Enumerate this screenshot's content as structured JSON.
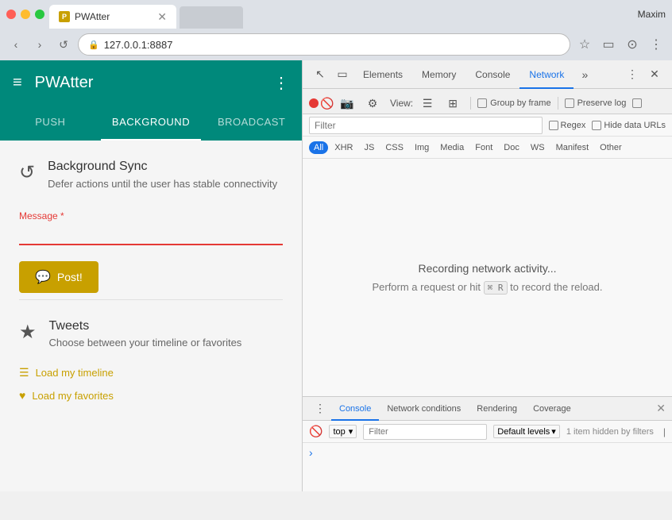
{
  "browser": {
    "traffic_lights": [
      "red",
      "yellow",
      "green"
    ],
    "tab": {
      "favicon_label": "P",
      "title": "PWAtter",
      "close": "✕"
    },
    "nav": {
      "back": "‹",
      "forward": "›",
      "reload": "↺",
      "url_icon": "🔒",
      "url": "127.0.0.1:8887",
      "bookmark": "☆",
      "cast": "▭",
      "profile": "⊙",
      "more": "⋮"
    },
    "user": "Maxim"
  },
  "app": {
    "header": {
      "menu_icon": "≡",
      "title": "PWAtter",
      "more_icon": "⋮"
    },
    "tabs": [
      {
        "label": "Push",
        "active": false
      },
      {
        "label": "Background",
        "active": true
      },
      {
        "label": "Broadcast",
        "active": false
      }
    ],
    "sync": {
      "icon": "↺",
      "title": "Background Sync",
      "description": "Defer actions until the user has stable connectivity"
    },
    "form": {
      "message_label": "Message *",
      "message_value": "",
      "post_icon": "💬",
      "post_label": "Post!"
    },
    "tweets": {
      "icon": "★",
      "title": "Tweets",
      "description": "Choose between your timeline or favorites",
      "links": [
        {
          "icon": "☰",
          "label": "Load my timeline"
        },
        {
          "icon": "♥",
          "label": "Load my favorites"
        }
      ]
    }
  },
  "devtools": {
    "toolbar": {
      "icon1": "↖",
      "icon2": "▭",
      "tabs": [
        "Elements",
        "Memory",
        "Console",
        "Network"
      ],
      "active_tab": "Network",
      "more": "»",
      "extra": "⋮",
      "close": "✕"
    },
    "subbar": {
      "view_label": "View:",
      "group_by_frame": "Group by frame",
      "preserve_log": "Preserve log"
    },
    "filter": {
      "placeholder": "Filter",
      "regex_label": "Regex",
      "hide_data_urls_label": "Hide data URLs"
    },
    "request_types": [
      "All",
      "XHR",
      "JS",
      "CSS",
      "Img",
      "Media",
      "Font",
      "Doc",
      "WS",
      "Manifest",
      "Other"
    ],
    "active_type": "All",
    "body": {
      "line1": "Recording network activity...",
      "line2": "Perform a request or hit",
      "key": "⌘ R",
      "line2_suffix": "to record the reload."
    },
    "console": {
      "tabs": [
        "Console",
        "Network conditions",
        "Rendering",
        "Coverage"
      ],
      "active_tab": "Console",
      "close": "✕",
      "context": "top",
      "filter_placeholder": "Filter",
      "level": "Default levels",
      "hidden": "1 item hidden by filters",
      "chevron": "›"
    }
  }
}
